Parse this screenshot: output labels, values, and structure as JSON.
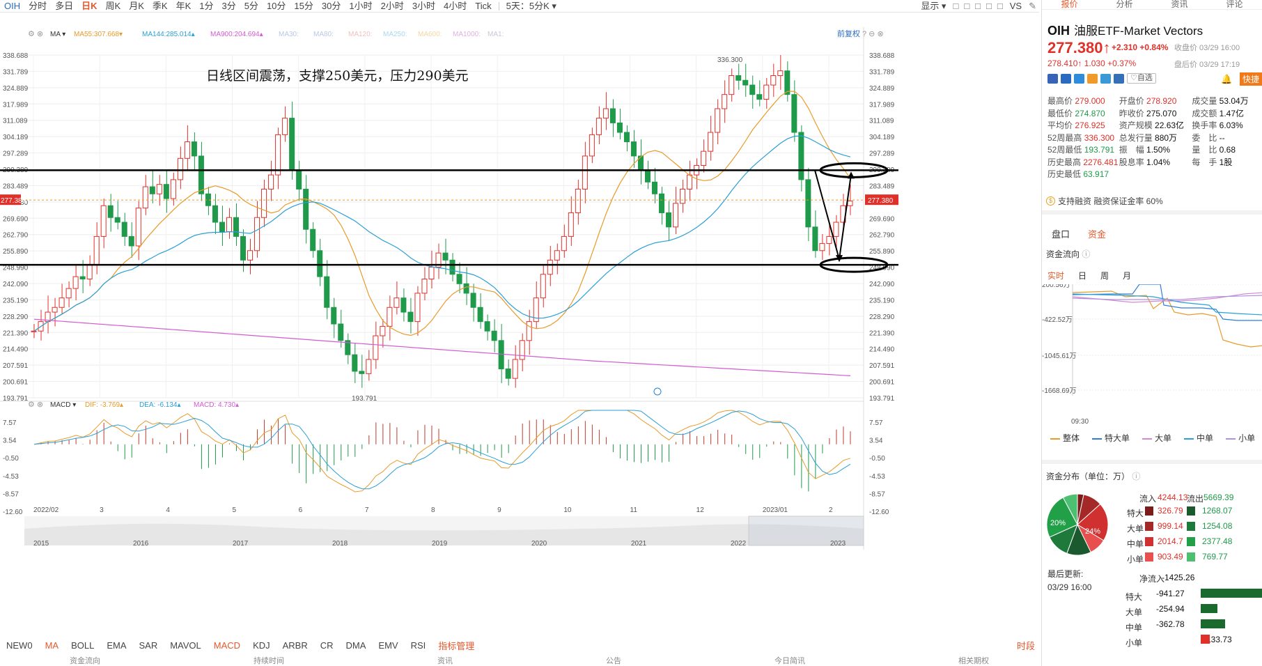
{
  "toolbar": {
    "symbol": "OIH",
    "periods": [
      "分时",
      "多日",
      "日K",
      "周K",
      "月K",
      "季K",
      "年K",
      "1分",
      "3分",
      "5分",
      "10分",
      "15分",
      "30分",
      "1小时",
      "2小时",
      "3小时",
      "4小时",
      "Tick"
    ],
    "active_period": "日K",
    "range_select": "5天：5分K",
    "show_label": "显示",
    "vs_label": "VS"
  },
  "chart": {
    "indicator_name": "MA",
    "ma_legend": [
      {
        "label": "MA55:",
        "value": "307.668",
        "color": "#e89a2a",
        "arrow": "▾"
      },
      {
        "label": "MA144:",
        "value": "285.014",
        "color": "#2a9fd6",
        "arrow": "▴"
      },
      {
        "label": "MA900:",
        "value": "204.694",
        "color": "#d45ad0",
        "arrow": "▴"
      },
      {
        "label": "MA30:",
        "value": "",
        "color": "#b9c7e6",
        "arrow": ""
      },
      {
        "label": "MA80:",
        "value": "",
        "color": "#b9c7e6",
        "arrow": ""
      },
      {
        "label": "MA120:",
        "value": "",
        "color": "#f0c0c0",
        "arrow": ""
      },
      {
        "label": "MA250:",
        "value": "",
        "color": "#a8d8f0",
        "arrow": ""
      },
      {
        "label": "MA600:",
        "value": "",
        "color": "#f3d7a0",
        "arrow": ""
      },
      {
        "label": "MA1000:",
        "value": "",
        "color": "#e0b0e0",
        "arrow": ""
      },
      {
        "label": "MA1:",
        "value": "",
        "color": "#c8c8d8",
        "arrow": ""
      }
    ],
    "adjust_label": "前复权",
    "annotation": "日线区间震荡，支撑250美元，压力290美元",
    "high_label": "336.300",
    "low_label": "193.791",
    "price_ticks": [
      "338.688",
      "331.789",
      "324.889",
      "317.989",
      "311.089",
      "304.189",
      "297.289",
      "290.389",
      "283.489",
      "277.380",
      "269.690",
      "262.790",
      "255.890",
      "248.990",
      "242.090",
      "235.190",
      "228.290",
      "221.390",
      "214.490",
      "207.591",
      "200.691",
      "193.791"
    ],
    "current_price_tag": "277.380",
    "date_ticks": [
      "2022/02",
      "3",
      "4",
      "5",
      "6",
      "7",
      "8",
      "9",
      "10",
      "11",
      "12",
      "2023/01",
      "2"
    ],
    "macd_name": "MACD",
    "macd_legend": [
      {
        "label": "DIF:",
        "value": "-3.769",
        "color": "#e89a2a",
        "arrow": "▴"
      },
      {
        "label": "DEA:",
        "value": "-6.134",
        "color": "#2a9fd6",
        "arrow": "▴"
      },
      {
        "label": "MACD:",
        "value": "4.730",
        "color": "#d45ad0",
        "arrow": "▴"
      }
    ],
    "macd_ticks": [
      "7.57",
      "3.54",
      "-0.50",
      "-4.53",
      "-8.57",
      "-12.60"
    ],
    "overview_years": [
      "2015",
      "2016",
      "2017",
      "2018",
      "2019",
      "2020",
      "2021",
      "2022",
      "2023"
    ]
  },
  "bottom_tabs": [
    "NEW0",
    "MA",
    "BOLL",
    "EMA",
    "SAR",
    "MAVOL",
    "MACD",
    "KDJ",
    "ARBR",
    "CR",
    "DMA",
    "EMV",
    "RSI",
    "指标管理"
  ],
  "bottom_active": [
    "MA",
    "MACD"
  ],
  "timing_label": "时段",
  "footer_labels": [
    "资金流向",
    "持续时间",
    "资讯",
    "公告",
    "今日简讯",
    "相关期权"
  ],
  "panel": {
    "tabs": [
      "报价",
      "分析",
      "资讯",
      "评论"
    ],
    "active_tab": "报价",
    "symbol": "OIH",
    "name": "油服ETF-Market Vectors",
    "price": "277.380",
    "price_arrow": "↑",
    "change": "+2.310",
    "change_pct": "+0.84%",
    "close_time": "收盘价 03/29 16:00",
    "after_hours": "278.410↑ 1.030 +0.37%",
    "after_time": "盘后价 03/29 17:19",
    "watch_label": "♡自选",
    "quick_label": "快捷",
    "stats": [
      [
        {
          "l": "最高价",
          "v": "279.000",
          "c": "red"
        },
        {
          "l": "开盘价",
          "v": "278.920",
          "c": "red"
        },
        {
          "l": "成交量",
          "v": "53.04万",
          "c": "dark"
        }
      ],
      [
        {
          "l": "最低价",
          "v": "274.870",
          "c": "green"
        },
        {
          "l": "昨收价",
          "v": "275.070",
          "c": "dark"
        },
        {
          "l": "成交额",
          "v": "1.47亿",
          "c": "dark"
        }
      ],
      [
        {
          "l": "平均价",
          "v": "276.925",
          "c": "red"
        },
        {
          "l": "资产规模",
          "v": "22.63亿",
          "c": "dark"
        },
        {
          "l": "换手率",
          "v": "6.03%",
          "c": "dark"
        }
      ],
      [
        {
          "l": "52周最高",
          "v": "336.300",
          "c": "red"
        },
        {
          "l": "总发行量",
          "v": "880万",
          "c": "dark"
        },
        {
          "l": "委　比",
          "v": "--",
          "c": "dark"
        }
      ],
      [
        {
          "l": "52周最低",
          "v": "193.791",
          "c": "green"
        },
        {
          "l": "振　幅",
          "v": "1.50%",
          "c": "dark"
        },
        {
          "l": "量　比",
          "v": "0.68",
          "c": "dark"
        }
      ],
      [
        {
          "l": "历史最高",
          "v": "2276.481",
          "c": "red"
        },
        {
          "l": "股息率",
          "v": "1.04%",
          "c": "dark"
        },
        {
          "l": "每　手",
          "v": "1股",
          "c": "dark"
        }
      ],
      [
        {
          "l": "历史最低",
          "v": "63.917",
          "c": "green"
        }
      ]
    ],
    "margin_text": "支持融资 融资保证金率 60%",
    "capital_tabs": [
      "盘口",
      "资金"
    ],
    "capital_active": "资金",
    "flow_title": "资金流向",
    "flow_tabs": [
      "实时",
      "日",
      "周",
      "月"
    ],
    "flow_active": "实时",
    "flow_yticks": [
      "200.56万",
      "-422.52万",
      "-1045.61万",
      "-1668.69万"
    ],
    "flow_xtick": "09:30",
    "flow_legend": [
      {
        "name": "整体",
        "color": "#e89a2a"
      },
      {
        "name": "特大单",
        "color": "#2a7fd6"
      },
      {
        "name": "大单",
        "color": "#d488d0"
      },
      {
        "name": "中单",
        "color": "#2aa0d6"
      },
      {
        "name": "小单",
        "color": "#b090e0"
      }
    ],
    "distrib_title": "资金分布（单位：万）",
    "pie_labels": [
      "20%",
      "24%"
    ],
    "inflow_header": "流入",
    "inflow_total": "4244.13",
    "outflow_header": "流出",
    "outflow_total": "5669.39",
    "dist_rows": [
      {
        "name": "特大",
        "in": "326.79",
        "out": "1268.07"
      },
      {
        "name": "大单",
        "in": "999.14",
        "out": "1254.08"
      },
      {
        "name": "中单",
        "in": "2014.7",
        "out": "2377.48"
      },
      {
        "name": "小单",
        "in": "903.49",
        "out": "769.77"
      }
    ],
    "updated_label": "最后更新:",
    "updated_time": "03/29 16:00",
    "net_label": "净流入",
    "net_total": "-1425.26",
    "net_rows": [
      {
        "name": "特大",
        "v": "-941.27",
        "amount": -941.27
      },
      {
        "name": "大单",
        "v": "-254.94",
        "amount": -254.94
      },
      {
        "name": "中单",
        "v": "-362.78",
        "amount": -362.78
      },
      {
        "name": "小单",
        "v": "133.73",
        "amount": 133.73
      }
    ]
  },
  "chart_data": {
    "type": "candlestick",
    "title": "",
    "x_range": [
      "2022/02",
      "2023/03/29"
    ],
    "y_range": [
      193.791,
      338.688
    ],
    "high": 336.3,
    "low": 193.791,
    "last": 277.38,
    "support": 250,
    "resistance": 290,
    "ma_series": [
      {
        "name": "MA55",
        "last": 307.668
      },
      {
        "name": "MA144",
        "last": 285.014
      },
      {
        "name": "MA900",
        "last": 204.694
      }
    ],
    "macd": {
      "dif": -3.769,
      "dea": -6.134,
      "macd": 4.73,
      "y_range": [
        -12.6,
        7.57
      ]
    },
    "approx_closes": [
      222,
      226,
      230,
      232,
      236,
      240,
      245,
      244,
      250,
      262,
      275,
      270,
      268,
      262,
      258,
      274,
      283,
      280,
      284,
      278,
      286,
      295,
      302,
      296,
      280,
      275,
      268,
      264,
      270,
      262,
      252,
      256,
      270,
      282,
      288,
      305,
      312,
      290,
      282,
      265,
      256,
      245,
      232,
      225,
      218,
      212,
      205,
      204,
      210,
      220,
      224,
      232,
      236,
      230,
      226,
      238,
      244,
      249,
      255,
      252,
      246,
      242,
      238,
      232,
      226,
      222,
      218,
      206,
      202,
      210,
      218,
      226,
      236,
      246,
      252,
      256,
      262,
      272,
      282,
      296,
      305,
      312,
      316,
      310,
      306,
      302,
      296,
      290,
      285,
      280,
      272,
      266,
      276,
      282,
      288,
      292,
      298,
      306,
      316,
      322,
      330,
      328,
      326,
      322,
      320,
      326,
      330,
      332,
      322,
      306,
      286,
      266,
      256,
      259,
      262,
      268,
      275,
      277
    ]
  }
}
